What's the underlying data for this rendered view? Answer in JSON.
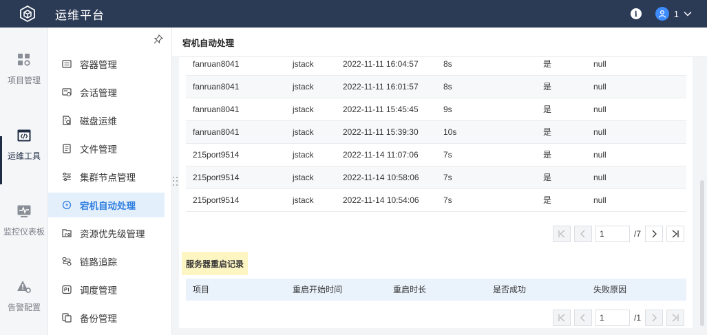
{
  "app": {
    "title": "运维平台"
  },
  "header": {
    "user_name": "1"
  },
  "rail": {
    "items": [
      {
        "label": "项目管理",
        "icon": "grid-gear-icon"
      },
      {
        "label": "运维工具",
        "icon": "code-window-icon",
        "active": true
      },
      {
        "label": "监控仪表板",
        "icon": "monitor-pulse-icon"
      },
      {
        "label": "告警配置",
        "icon": "alert-gear-icon"
      }
    ]
  },
  "menu": {
    "items": [
      {
        "label": "容器管理",
        "icon": "container-icon"
      },
      {
        "label": "会话管理",
        "icon": "session-icon"
      },
      {
        "label": "磁盘运维",
        "icon": "disk-icon"
      },
      {
        "label": "文件管理",
        "icon": "file-icon"
      },
      {
        "label": "集群节点管理",
        "icon": "sliders-icon"
      },
      {
        "label": "宕机自动处理",
        "icon": "auto-recover-icon",
        "active": true
      },
      {
        "label": "资源优先级管理",
        "icon": "resource-icon"
      },
      {
        "label": "链路追踪",
        "icon": "trace-icon"
      },
      {
        "label": "调度管理",
        "icon": "schedule-icon"
      },
      {
        "label": "备份管理",
        "icon": "backup-icon"
      }
    ]
  },
  "page": {
    "title": "宕机自动处理"
  },
  "table1": {
    "rows": [
      [
        "fanruan8041",
        "jstack",
        "2022-11-11 16:04:57",
        "8s",
        "是",
        "null"
      ],
      [
        "fanruan8041",
        "jstack",
        "2022-11-11 16:01:57",
        "8s",
        "是",
        "null"
      ],
      [
        "fanruan8041",
        "jstack",
        "2022-11-11 15:45:45",
        "9s",
        "是",
        "null"
      ],
      [
        "fanruan8041",
        "jstack",
        "2022-11-11 15:39:30",
        "10s",
        "是",
        "null"
      ],
      [
        "215port9514",
        "jstack",
        "2022-11-14 11:07:06",
        "7s",
        "是",
        "null"
      ],
      [
        "215port9514",
        "jstack",
        "2022-11-14 10:58:06",
        "7s",
        "是",
        "null"
      ],
      [
        "215port9514",
        "jstack",
        "2022-11-14 10:54:06",
        "7s",
        "是",
        "null"
      ]
    ],
    "pager": {
      "page": "1",
      "total": "/7"
    }
  },
  "restart": {
    "title": "服务器重启记录",
    "columns": [
      "项目",
      "重启开始时间",
      "重启时长",
      "是否成功",
      "失败原因"
    ],
    "pager": {
      "page": "1",
      "total": "/1"
    }
  },
  "colors": {
    "topbar": "#2b3a55",
    "accent": "#2f7fe0",
    "active_bg": "#e4effc",
    "tag_bg": "#fdf6c3"
  }
}
